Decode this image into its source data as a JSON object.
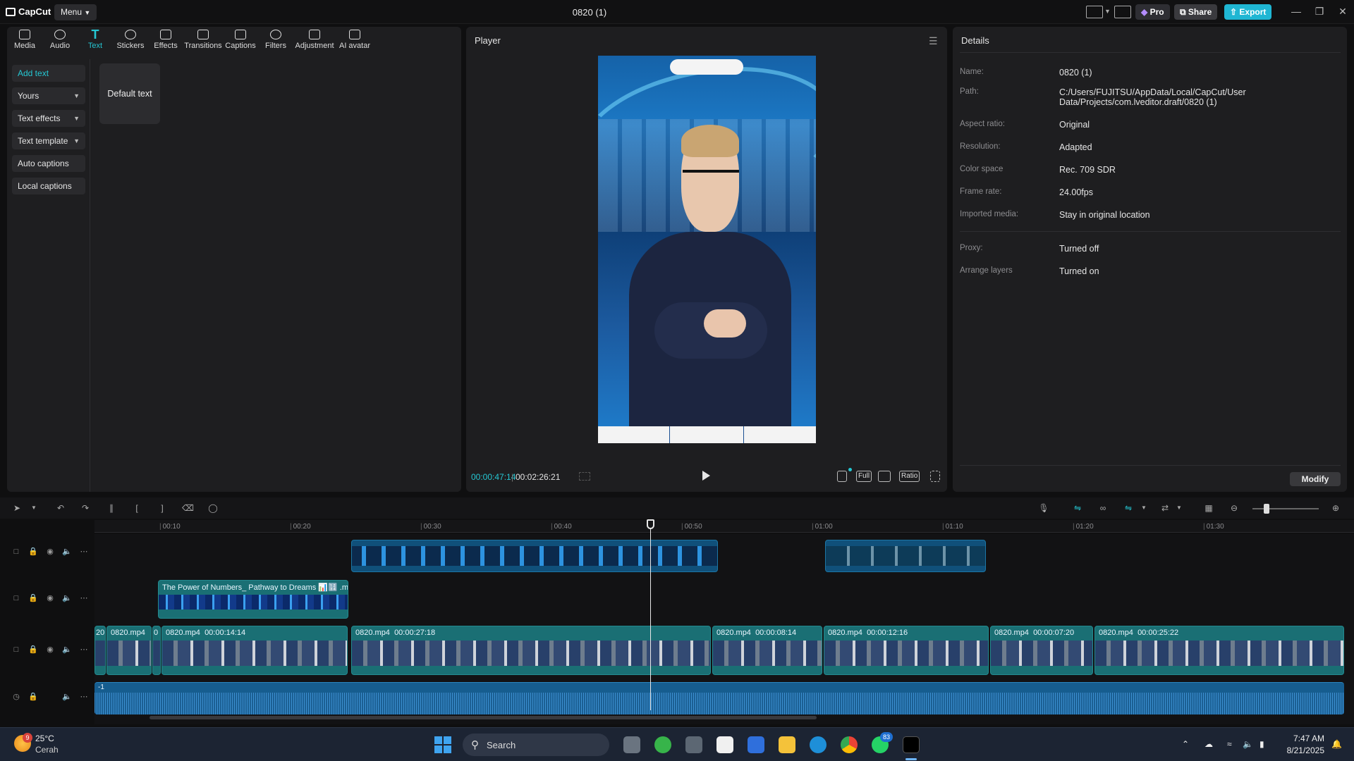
{
  "app": {
    "logo_text": "CapCut",
    "menu_label": "Menu",
    "title": "0820 (1)",
    "pro_label": "Pro",
    "share_label": "Share",
    "export_label": "Export"
  },
  "toolbar": [
    {
      "label": "Media",
      "icon": "media-icon"
    },
    {
      "label": "Audio",
      "icon": "audio-icon"
    },
    {
      "label": "Text",
      "icon": "text-icon",
      "active": true
    },
    {
      "label": "Stickers",
      "icon": "stickers-icon"
    },
    {
      "label": "Effects",
      "icon": "effects-icon"
    },
    {
      "label": "Transitions",
      "icon": "transitions-icon"
    },
    {
      "label": "Captions",
      "icon": "captions-icon"
    },
    {
      "label": "Filters",
      "icon": "filters-icon"
    },
    {
      "label": "Adjustment",
      "icon": "adjustment-icon"
    },
    {
      "label": "AI avatar",
      "icon": "ai-avatar-icon"
    }
  ],
  "text_panel": {
    "items": [
      "Add text",
      "Yours",
      "Text effects",
      "Text template",
      "Auto captions",
      "Local captions"
    ],
    "default_card": "Default text"
  },
  "player": {
    "title": "Player",
    "current_time": "00:00:47:14",
    "total_time": "00:02:26:21",
    "full_label": "Full",
    "ratio_label": "Ratio"
  },
  "details": {
    "title": "Details",
    "rows": [
      {
        "key": "Name:",
        "value": "0820 (1)"
      },
      {
        "key": "Path:",
        "value": "C:/Users/FUJITSU/AppData/Local/CapCut/User Data/Projects/com.lveditor.draft/0820 (1)"
      },
      {
        "key": "Aspect ratio:",
        "value": "Original"
      },
      {
        "key": "Resolution:",
        "value": "Adapted"
      },
      {
        "key": "Color space",
        "value": "Rec. 709 SDR"
      },
      {
        "key": "Frame rate:",
        "value": "24.00fps"
      },
      {
        "key": "Imported media:",
        "value": "Stay in original location"
      },
      {
        "key": "Proxy:",
        "value": "Turned off"
      },
      {
        "key": "Arrange layers",
        "value": "Turned on"
      }
    ],
    "modify_label": "Modify"
  },
  "timeline": {
    "ruler": [
      "00:10",
      "00:20",
      "00:30",
      "00:40",
      "00:50",
      "01:00",
      "01:10",
      "01:20",
      "01:30"
    ],
    "overlay_clip_label": "The Power of Numbers_ Pathway to Dreams 📊🔢 .mp4",
    "main_clips": [
      {
        "name": "20",
        "dur": ""
      },
      {
        "name": "0820.mp4",
        "dur": ""
      },
      {
        "name": "0",
        "dur": ""
      },
      {
        "name": "0820.mp4",
        "dur": "00:00:14:14"
      },
      {
        "name": "0820.mp4",
        "dur": "00:00:27:18"
      },
      {
        "name": "0820.mp4",
        "dur": "00:00:08:14"
      },
      {
        "name": "0820.mp4",
        "dur": "00:00:12:16"
      },
      {
        "name": "0820.mp4",
        "dur": "00:00:07:20"
      },
      {
        "name": "0820.mp4",
        "dur": "00:00:25:22"
      }
    ],
    "audio_label": "-1"
  },
  "taskbar": {
    "weather_temp": "25°C",
    "weather_desc": "Cerah",
    "weather_badge": "9",
    "search_label": "Search",
    "whatsapp_badge": "83",
    "time": "7:47 AM",
    "date": "8/21/2025"
  },
  "colors": {
    "accent": "#25c7d3",
    "export": "#1fb6d3",
    "panel": "#1e1e20"
  }
}
